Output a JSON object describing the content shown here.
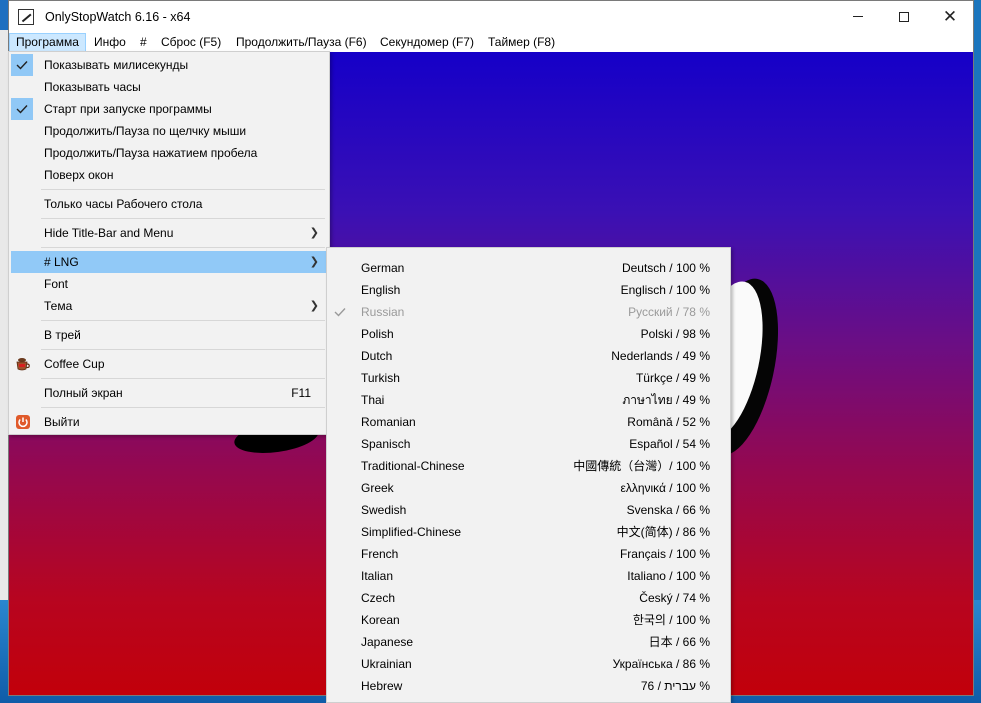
{
  "window": {
    "title": "OnlyStopWatch 6.16 - x64",
    "controls": {
      "minimize": "minimize",
      "maximize": "maximize",
      "close": "✕"
    }
  },
  "menubar": {
    "items": [
      "Программа",
      "Инфо",
      "#",
      "Сброс  (F5)",
      "Продолжить/Пауза (F6)",
      "Секундомер  (F7)",
      "Таймер  (F8)"
    ]
  },
  "program_menu": {
    "items": [
      {
        "label": "Показывать милисекунды",
        "checked": true
      },
      {
        "label": "Показывать часы",
        "checked": false
      },
      {
        "label": "Старт при запуске программы",
        "checked": true
      },
      {
        "label": "Продолжить/Пауза по щелчку мыши",
        "checked": false
      },
      {
        "label": "Продолжить/Пауза нажатием пробела",
        "checked": false
      },
      {
        "label": "Поверх окон",
        "checked": false
      },
      {
        "label": "Только часы Рабочего стола"
      },
      {
        "label": "Hide Title-Bar and Menu",
        "submenu": true
      },
      {
        "label": "# LNG",
        "submenu": true,
        "highlighted": true
      },
      {
        "label": "Font"
      },
      {
        "label": "Тема",
        "submenu": true
      },
      {
        "label": "В трей"
      },
      {
        "label": "Coffee Cup",
        "icon": "coffee-cup-icon"
      },
      {
        "label": "Полный экран",
        "accelerator": "F11"
      },
      {
        "label": "Выйти",
        "icon": "power-icon"
      }
    ]
  },
  "language_menu": {
    "items": [
      {
        "name": "German",
        "native": "Deutsch / 100 %"
      },
      {
        "name": "English",
        "native": "Englisch / 100 %"
      },
      {
        "name": "Russian",
        "native": "Русский / 78 %",
        "checked": true,
        "disabled": true
      },
      {
        "name": "Polish",
        "native": "Polski / 98 %"
      },
      {
        "name": "Dutch",
        "native": "Nederlands / 49 %"
      },
      {
        "name": "Turkish",
        "native": "Türkçe / 49 %"
      },
      {
        "name": "Thai",
        "native": "ภาษาไทย / 49 %"
      },
      {
        "name": "Romanian",
        "native": "Română / 52 %"
      },
      {
        "name": "Spanisch",
        "native": "Español / 54 %"
      },
      {
        "name": "Traditional-Chinese",
        "native": "中國傳統（台灣）/ 100 %"
      },
      {
        "name": "Greek",
        "native": "ελληνικά / 100 %"
      },
      {
        "name": "Swedish",
        "native": "Svenska / 66 %"
      },
      {
        "name": "Simplified-Chinese",
        "native": "中文(简体) / 86 %"
      },
      {
        "name": "French",
        "native": "Français / 100 %"
      },
      {
        "name": "Italian",
        "native": "Italiano / 100 %"
      },
      {
        "name": "Czech",
        "native": "Český / 74 %"
      },
      {
        "name": "Korean",
        "native": "한국의 / 100 %"
      },
      {
        "name": "Japanese",
        "native": "日本 / 66 %"
      },
      {
        "name": "Ukrainian",
        "native": "Українська / 86 %"
      },
      {
        "name": "Hebrew",
        "native": "עברית / 76 %"
      }
    ]
  }
}
